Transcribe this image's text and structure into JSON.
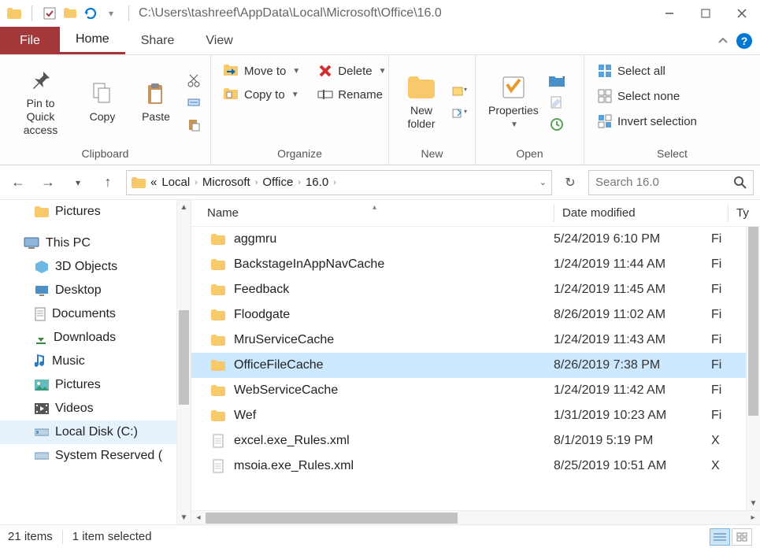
{
  "titlebar": {
    "path": "C:\\Users\\tashreef\\AppData\\Local\\Microsoft\\Office\\16.0"
  },
  "tabs": {
    "file": "File",
    "home": "Home",
    "share": "Share",
    "view": "View"
  },
  "ribbon": {
    "clipboard": {
      "label": "Clipboard",
      "pin": "Pin to Quick access",
      "copy": "Copy",
      "paste": "Paste"
    },
    "organize": {
      "label": "Organize",
      "moveto": "Move to",
      "copyto": "Copy to",
      "delete": "Delete",
      "rename": "Rename"
    },
    "new": {
      "label": "New",
      "newfolder": "New folder"
    },
    "open": {
      "label": "Open",
      "properties": "Properties"
    },
    "select": {
      "label": "Select",
      "all": "Select all",
      "none": "Select none",
      "invert": "Invert selection"
    }
  },
  "address": {
    "ellipsis": "«",
    "crumbs": [
      "Local",
      "Microsoft",
      "Office",
      "16.0"
    ]
  },
  "search": {
    "placeholder": "Search 16.0"
  },
  "navpane": {
    "pictures": "Pictures",
    "thispc": "This PC",
    "items": [
      "3D Objects",
      "Desktop",
      "Documents",
      "Downloads",
      "Music",
      "Pictures",
      "Videos",
      "Local Disk (C:)",
      "System Reserved ("
    ]
  },
  "columns": {
    "name": "Name",
    "date": "Date modified",
    "type": "Ty"
  },
  "rows": [
    {
      "icon": "folder",
      "name": "aggmru",
      "date": "5/24/2019 6:10 PM",
      "type": "Fi",
      "sel": false
    },
    {
      "icon": "folder",
      "name": "BackstageInAppNavCache",
      "date": "1/24/2019 11:44 AM",
      "type": "Fi",
      "sel": false
    },
    {
      "icon": "folder",
      "name": "Feedback",
      "date": "1/24/2019 11:45 AM",
      "type": "Fi",
      "sel": false
    },
    {
      "icon": "folder",
      "name": "Floodgate",
      "date": "8/26/2019 11:02 AM",
      "type": "Fi",
      "sel": false
    },
    {
      "icon": "folder",
      "name": "MruServiceCache",
      "date": "1/24/2019 11:43 AM",
      "type": "Fi",
      "sel": false
    },
    {
      "icon": "folder",
      "name": "OfficeFileCache",
      "date": "8/26/2019 7:38 PM",
      "type": "Fi",
      "sel": true
    },
    {
      "icon": "folder",
      "name": "WebServiceCache",
      "date": "1/24/2019 11:42 AM",
      "type": "Fi",
      "sel": false
    },
    {
      "icon": "folder",
      "name": "Wef",
      "date": "1/31/2019 10:23 AM",
      "type": "Fi",
      "sel": false
    },
    {
      "icon": "file",
      "name": "excel.exe_Rules.xml",
      "date": "8/1/2019 5:19 PM",
      "type": "X",
      "sel": false
    },
    {
      "icon": "file",
      "name": "msoia.exe_Rules.xml",
      "date": "8/25/2019 10:51 AM",
      "type": "X",
      "sel": false
    }
  ],
  "status": {
    "count": "21 items",
    "selected": "1 item selected"
  }
}
